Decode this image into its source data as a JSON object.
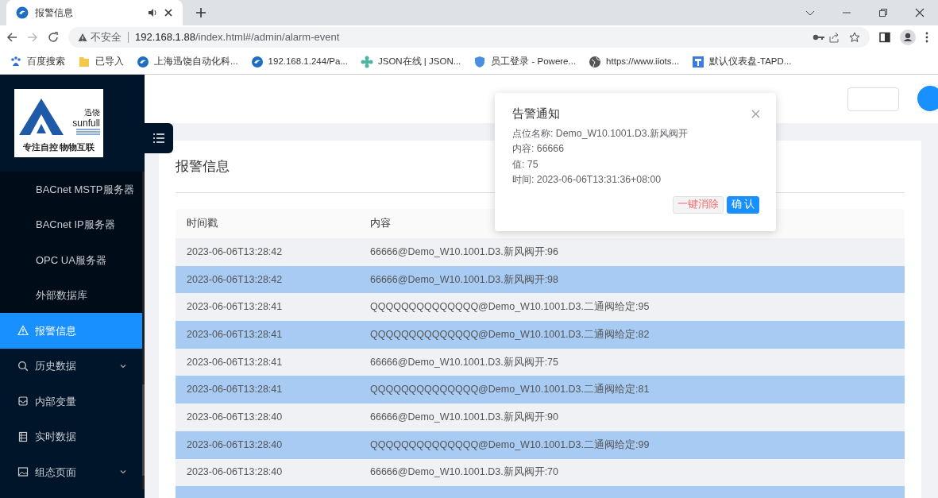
{
  "browser": {
    "tab": {
      "title": "报警信息",
      "audio": true
    },
    "url": {
      "security": "不安全",
      "host": "192.168.1.88",
      "path": "/index.html#/admin/alarm-event"
    },
    "bookmarks": [
      {
        "label": "百度搜索"
      },
      {
        "label": "已导入"
      },
      {
        "label": "上海迅饶自动化科..."
      },
      {
        "label": "192.168.1.244/Pa..."
      },
      {
        "label": "JSON在线 | JSON..."
      },
      {
        "label": "员工登录 - Powere..."
      },
      {
        "label": "https://www.iiots..."
      },
      {
        "label": "默认仪表盘-TAPD..."
      }
    ]
  },
  "logo": {
    "brand_cn": "迅饶",
    "brand": "sunfull",
    "slogan": "专注自控 物物互联"
  },
  "sidebar": {
    "items": [
      {
        "label": "BACnet MSTP服务器",
        "kind": "sub",
        "selected": false
      },
      {
        "label": "BACnet IP服务器",
        "kind": "sub",
        "selected": false
      },
      {
        "label": "OPC UA服务器",
        "kind": "sub",
        "selected": false
      },
      {
        "label": "外部数据库",
        "kind": "sub",
        "selected": false
      },
      {
        "label": "报警信息",
        "kind": "main",
        "selected": true,
        "expandable": false
      },
      {
        "label": "历史数据",
        "kind": "main",
        "selected": false,
        "expandable": true
      },
      {
        "label": "内部变量",
        "kind": "main",
        "selected": false,
        "expandable": false
      },
      {
        "label": "实时数据",
        "kind": "main",
        "selected": false,
        "expandable": false
      },
      {
        "label": "组态页面",
        "kind": "main",
        "selected": false,
        "expandable": true
      }
    ]
  },
  "page": {
    "title": "报警信息"
  },
  "table": {
    "columns": [
      "时间戳",
      "内容"
    ],
    "rows": [
      {
        "time": "2023-06-06T13:28:42",
        "content": "66666@Demo_W10.1001.D3.新风阀开:96",
        "highlighted": false
      },
      {
        "time": "2023-06-06T13:28:42",
        "content": "66666@Demo_W10.1001.D3.新风阀开:98",
        "highlighted": true
      },
      {
        "time": "2023-06-06T13:28:41",
        "content": "QQQQQQQQQQQQQQ@Demo_W10.1001.D3.二通阀给定:95",
        "highlighted": false
      },
      {
        "time": "2023-06-06T13:28:41",
        "content": "QQQQQQQQQQQQQQ@Demo_W10.1001.D3.二通阀给定:82",
        "highlighted": true
      },
      {
        "time": "2023-06-06T13:28:41",
        "content": "66666@Demo_W10.1001.D3.新风阀开:75",
        "highlighted": false
      },
      {
        "time": "2023-06-06T13:28:41",
        "content": "QQQQQQQQQQQQQQ@Demo_W10.1001.D3.二通阀给定:81",
        "highlighted": true
      },
      {
        "time": "2023-06-06T13:28:40",
        "content": "66666@Demo_W10.1001.D3.新风阀开:90",
        "highlighted": false
      },
      {
        "time": "2023-06-06T13:28:40",
        "content": "QQQQQQQQQQQQQQ@Demo_W10.1001.D3.二通阀给定:99",
        "highlighted": true
      },
      {
        "time": "2023-06-06T13:28:40",
        "content": "66666@Demo_W10.1001.D3.新风阀开:70",
        "highlighted": false
      }
    ]
  },
  "notification": {
    "title": "告警通知",
    "lines": [
      "点位名称: Demo_W10.1001.D3.新风阀开",
      "内容: 66666",
      "值: 75",
      "时间: 2023-06-06T13:31:36+08:00"
    ],
    "buttons": [
      {
        "label": "一键消除",
        "kind": "danger"
      },
      {
        "label": "确 认",
        "kind": "primary"
      }
    ]
  }
}
